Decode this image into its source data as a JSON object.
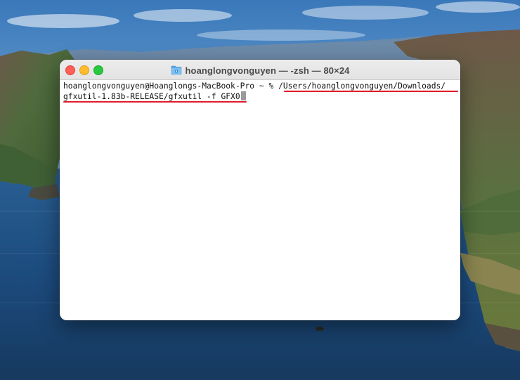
{
  "colors": {
    "sky_top": "#3f7fbf",
    "sea": "#1d4f84",
    "annotation_red": "#e01b2a",
    "close": "#ff5f57",
    "minimize": "#febc2e",
    "zoom": "#28c840"
  },
  "wallpaper": {
    "icon": "macos-big-sur-coast"
  },
  "window": {
    "title": "hoanglongvonguyen — -zsh — 80×24",
    "title_icon": "folder-icon",
    "controls": [
      "close",
      "minimize",
      "zoom"
    ]
  },
  "terminal": {
    "prompt": "hoanglongvonguyen@Hoanglongs-MacBook-Pro ~ % ",
    "command_part1": "/Users/hoanglongvonguyen/Downloads/",
    "command_part2": "gfxutil-1.83b-RELEASE/gfxutil -f GFX0",
    "annotation": "red-underline"
  }
}
